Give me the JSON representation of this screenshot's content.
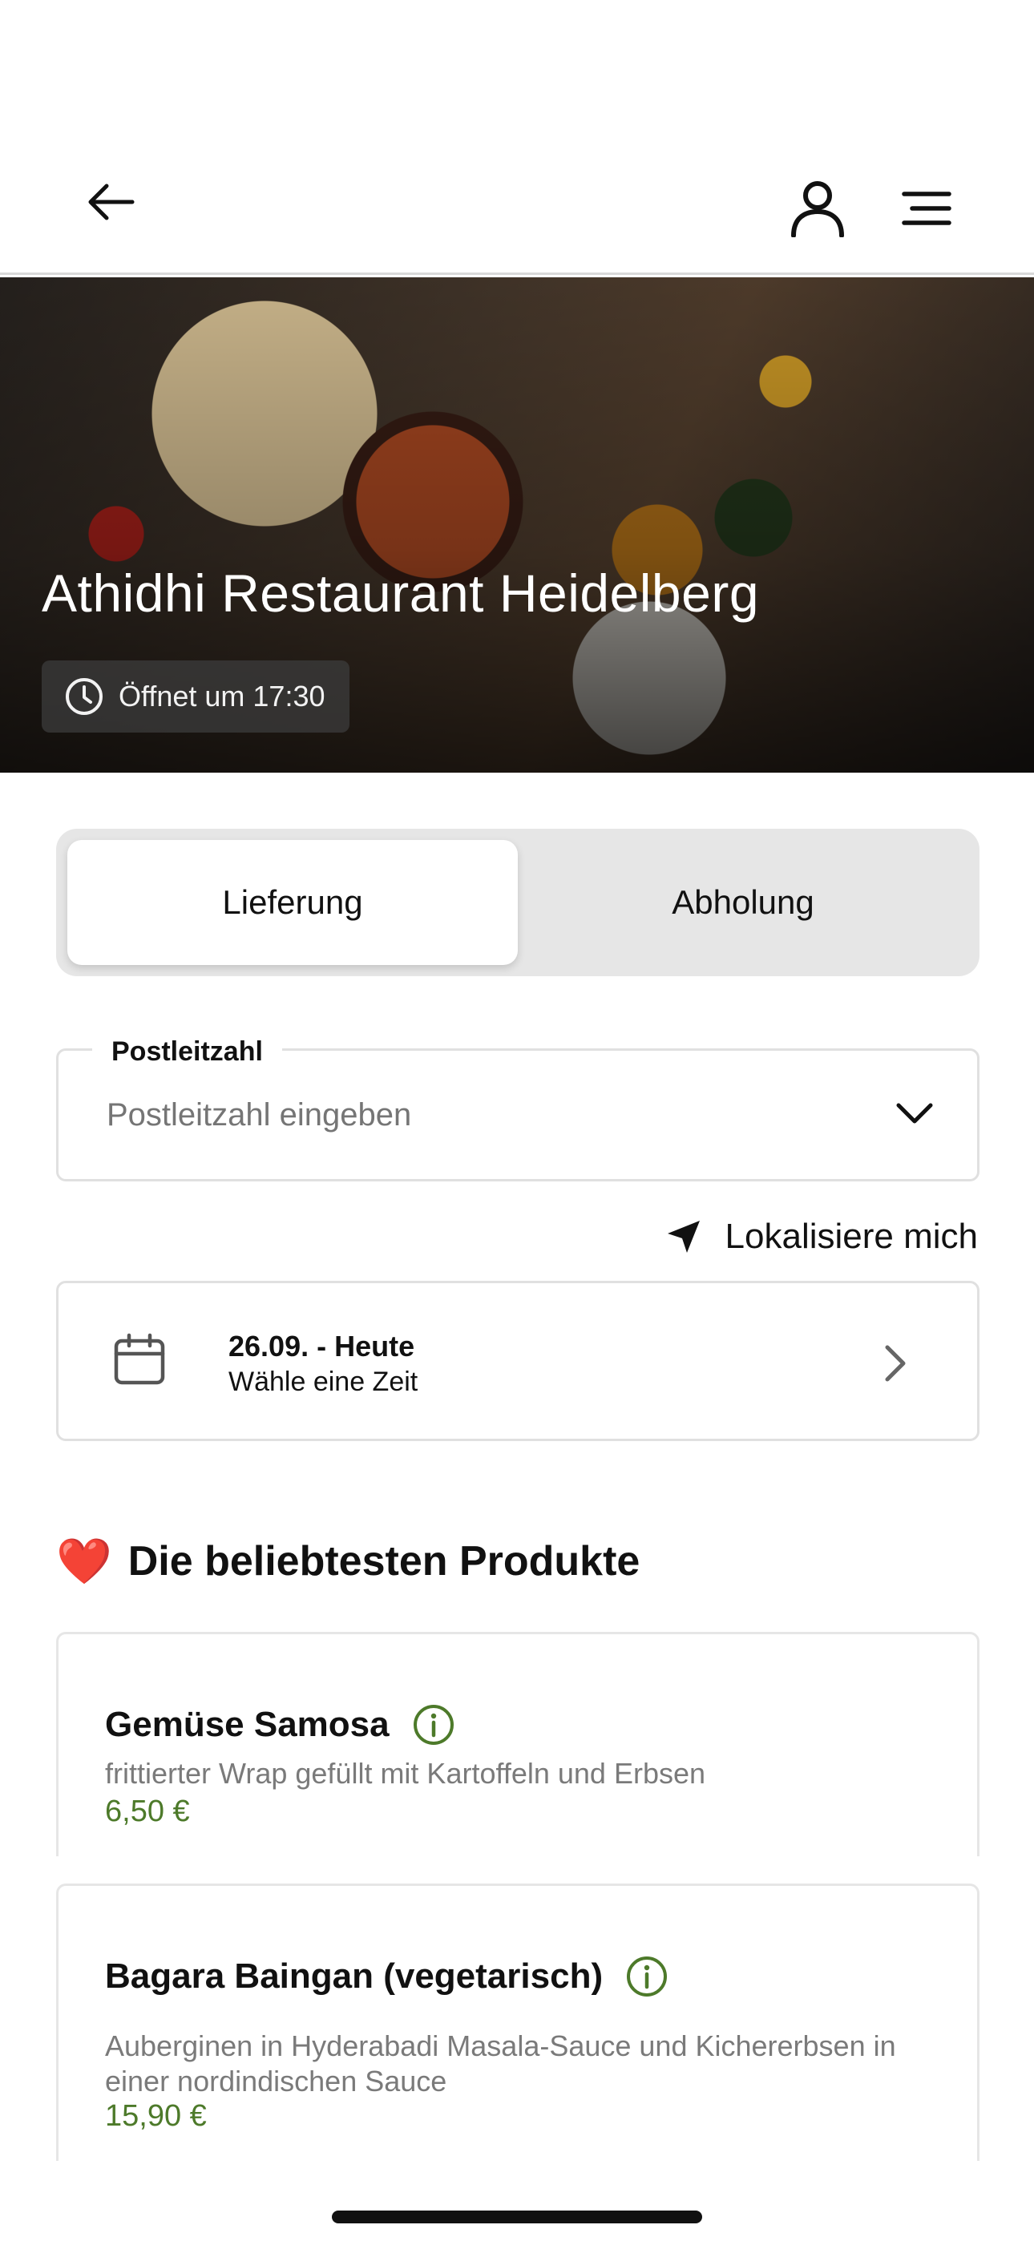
{
  "header": {
    "back_icon": "arrow-left-icon",
    "user_icon": "user-icon",
    "menu_icon": "menu-icon"
  },
  "hero": {
    "title": "Athidhi Restaurant Heidelberg",
    "open_status": "Öffnet um 17:30",
    "open_icon": "clock-icon"
  },
  "mode_toggle": {
    "options": [
      "Lieferung",
      "Abholung"
    ],
    "selected": "Lieferung"
  },
  "zip": {
    "label": "Postleitzahl",
    "placeholder": "Postleitzahl eingeben",
    "value": ""
  },
  "locate": {
    "label": "Lokalisiere mich",
    "icon": "location-arrow-icon"
  },
  "date_picker": {
    "date": "26.09. - Heute",
    "hint": "Wähle eine Zeit"
  },
  "popular": {
    "heart": "❤️",
    "title": "Die beliebtesten Produkte",
    "products": [
      {
        "name": "Gemüse Samosa",
        "description": "frittierter Wrap gefüllt mit Kartoffeln und Erbsen",
        "price": "6,50 €"
      },
      {
        "name": "Bagara Baingan (vegetarisch)",
        "description": "Auberginen in Hyderabadi Masala-Sauce und Kichererbsen in einer nordindischen Sauce",
        "price": "15,90 €"
      }
    ]
  },
  "colors": {
    "accent_green": "#4d7a2a",
    "border": "#e0e0e0",
    "segment_bg": "#e6e6e6"
  }
}
